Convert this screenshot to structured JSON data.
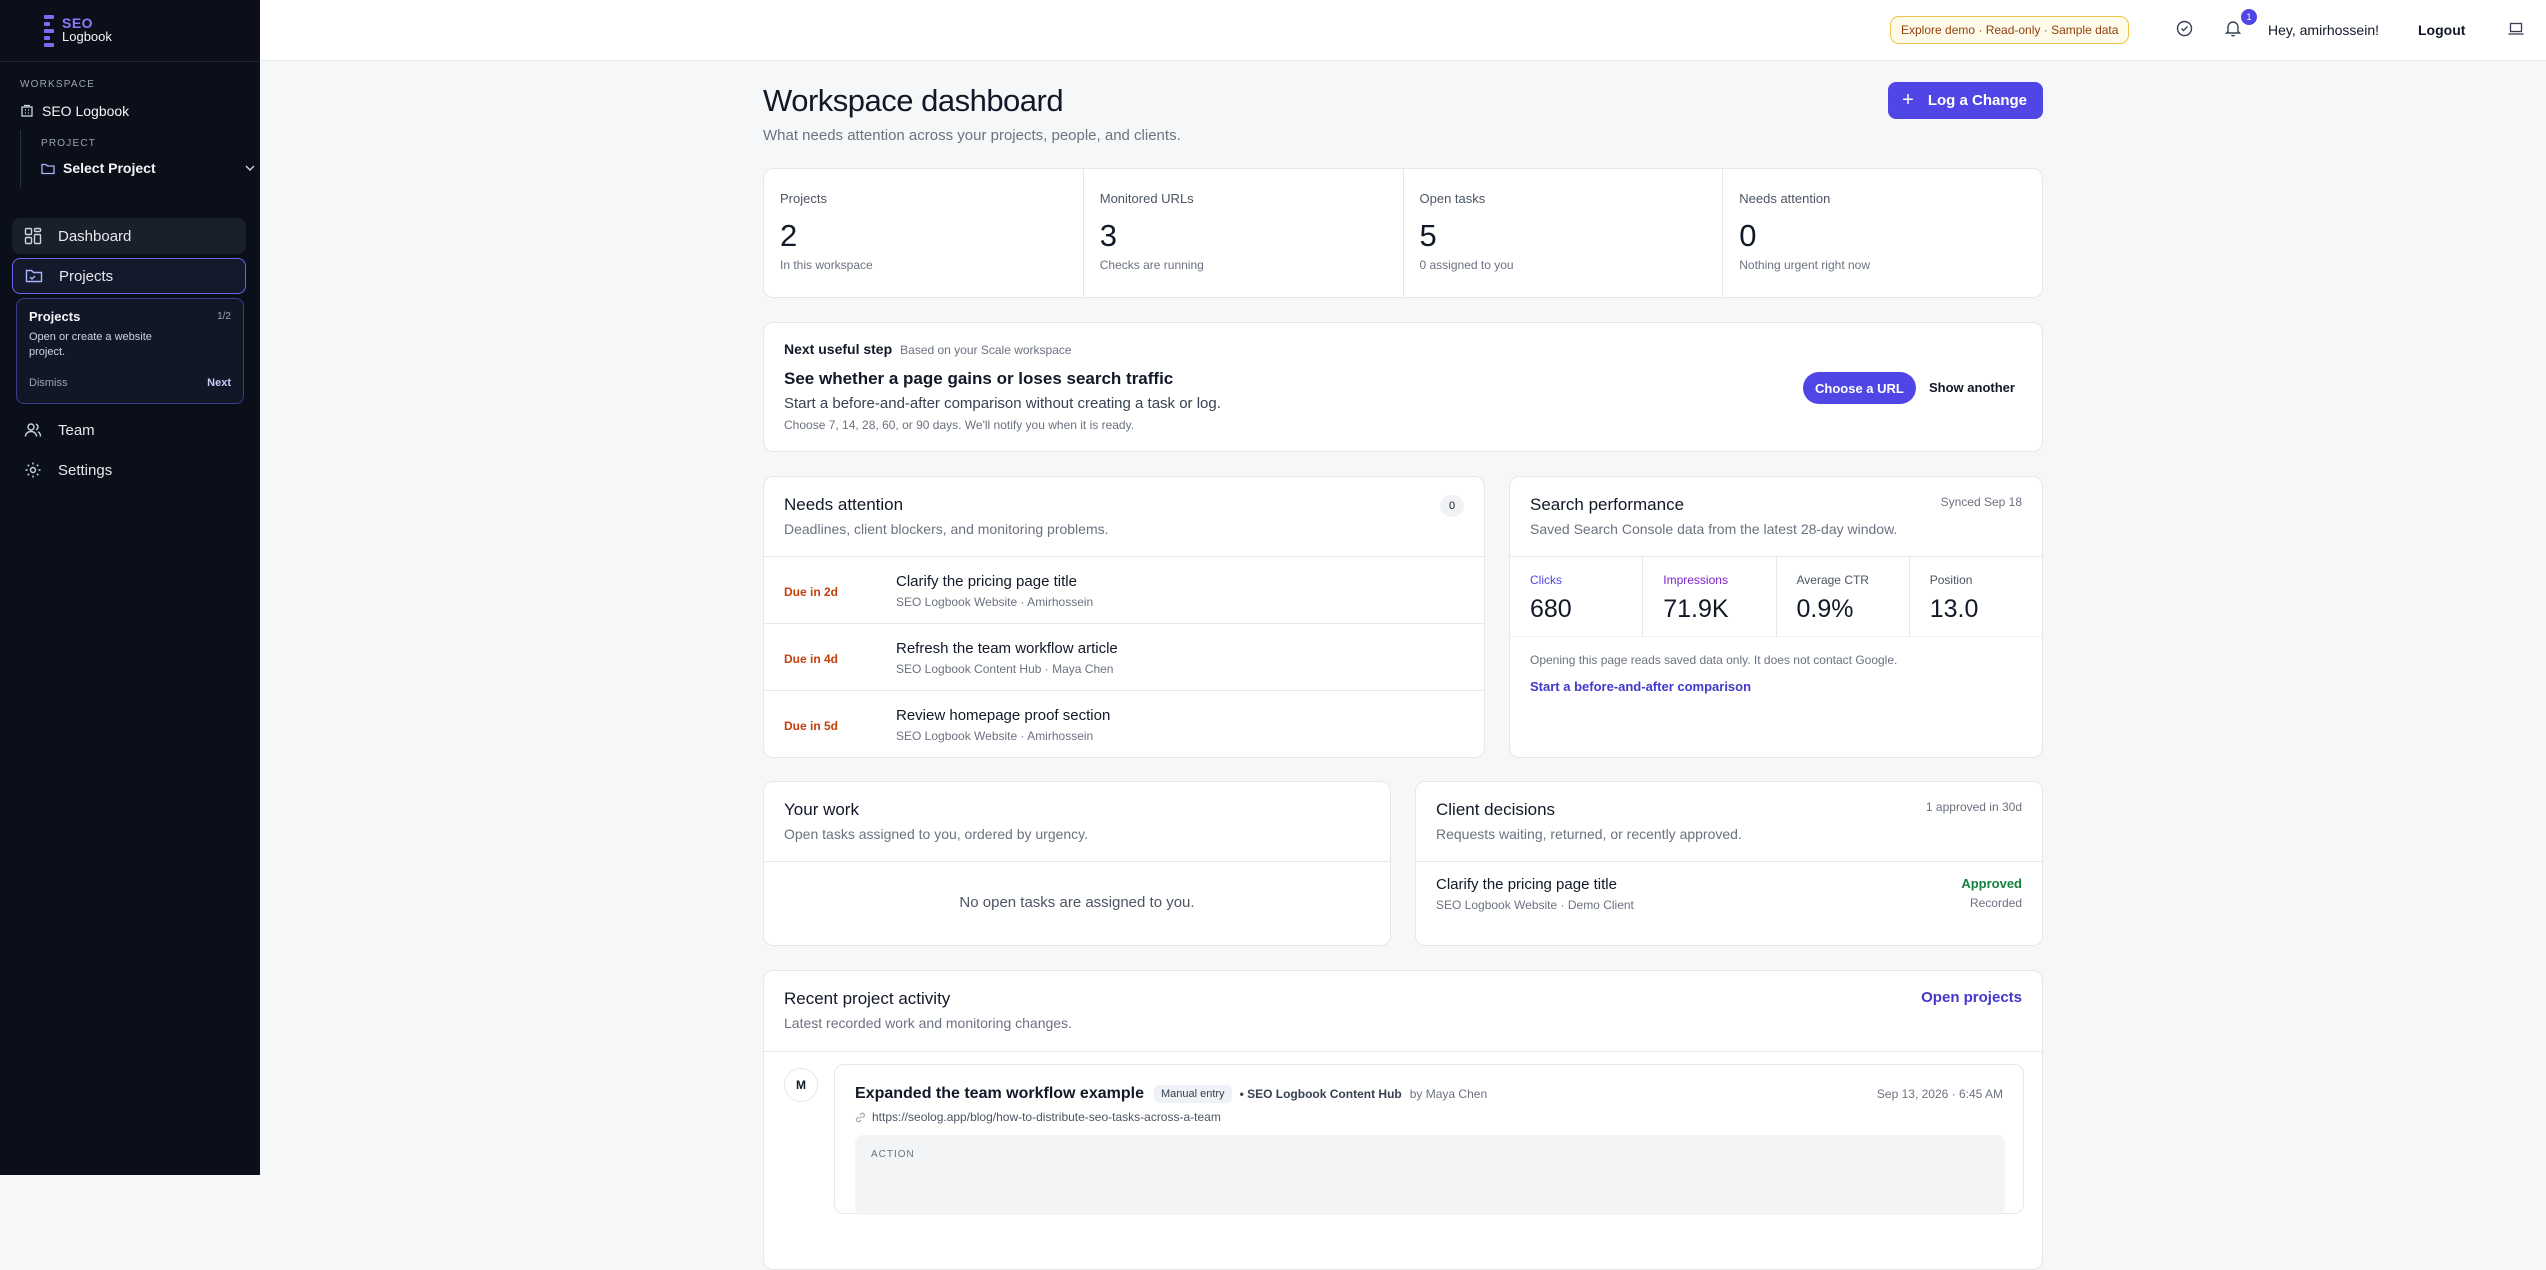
{
  "sidebar": {
    "logo_line1": "SEO",
    "logo_line2": "Logbook",
    "workspace_label": "WORKSPACE",
    "workspace_name": "SEO Logbook",
    "project_label": "PROJECT",
    "project_select": "Select Project",
    "nav": {
      "dashboard": "Dashboard",
      "projects": "Projects",
      "team": "Team",
      "settings": "Settings"
    },
    "tour": {
      "title": "Projects",
      "step": "1/2",
      "description": "Open or create a website project.",
      "dismiss": "Dismiss",
      "next": "Next"
    }
  },
  "topbar": {
    "demo_badge": "Explore demo · Read-only · Sample data",
    "notification_count": "1",
    "greeting": "Hey, amirhossein!",
    "logout": "Logout"
  },
  "header": {
    "title": "Workspace dashboard",
    "subtitle": "What needs attention across your projects, people, and clients.",
    "primary_button": "Log a Change"
  },
  "stats": [
    {
      "label": "Projects",
      "value": "2",
      "note": "In this workspace"
    },
    {
      "label": "Monitored URLs",
      "value": "3",
      "note": "Checks are running"
    },
    {
      "label": "Open tasks",
      "value": "5",
      "note": "0 assigned to you"
    },
    {
      "label": "Needs attention",
      "value": "0",
      "note": "Nothing urgent right now"
    }
  ],
  "next_step": {
    "label": "Next useful step",
    "context": "Based on your Scale workspace",
    "title": "See whether a page gains or loses search traffic",
    "description": "Start a before-and-after comparison without creating a task or log.",
    "note": "Choose 7, 14, 28, 60, or 90 days. We'll notify you when it is ready.",
    "primary": "Choose a URL",
    "secondary": "Show another"
  },
  "needs_attention": {
    "title": "Needs attention",
    "subtitle": "Deadlines, client blockers, and monitoring problems.",
    "count": "0",
    "rows": [
      {
        "due": "Due in 2d",
        "title": "Clarify the pricing page title",
        "meta": "SEO Logbook Website · Amirhossein"
      },
      {
        "due": "Due in 4d",
        "title": "Refresh the team workflow article",
        "meta": "SEO Logbook Content Hub · Maya Chen"
      },
      {
        "due": "Due in 5d",
        "title": "Review homepage proof section",
        "meta": "SEO Logbook Website · Amirhossein"
      }
    ]
  },
  "search_performance": {
    "title": "Search performance",
    "subtitle": "Saved Search Console data from the latest 28-day window.",
    "synced": "Synced Sep 18",
    "metrics": [
      {
        "label": "Clicks",
        "value": "680",
        "color": "#4f46e5"
      },
      {
        "label": "Impressions",
        "value": "71.9K",
        "color": "#7e22ce"
      },
      {
        "label": "Average CTR",
        "value": "0.9%",
        "color": "#4b5563"
      },
      {
        "label": "Position",
        "value": "13.0",
        "color": "#4b5563"
      }
    ],
    "note": "Opening this page reads saved data only. It does not contact Google.",
    "link": "Start a before-and-after comparison"
  },
  "your_work": {
    "title": "Your work",
    "subtitle": "Open tasks assigned to you, ordered by urgency.",
    "empty": "No open tasks are assigned to you."
  },
  "client_decisions": {
    "title": "Client decisions",
    "subtitle": "Requests waiting, returned, or recently approved.",
    "meta": "1 approved in 30d",
    "row": {
      "title": "Clarify the pricing page title",
      "meta": "SEO Logbook Website · Demo Client",
      "status": "Approved",
      "sub": "Recorded"
    }
  },
  "recent_activity": {
    "title": "Recent project activity",
    "subtitle": "Latest recorded work and monitoring changes.",
    "link": "Open projects",
    "item": {
      "avatar": "M",
      "title": "Expanded the team workflow example",
      "badge": "Manual entry",
      "project": "• SEO Logbook Content Hub",
      "by": "by Maya Chen",
      "date": "Sep 13, 2026 · 6:45 AM",
      "url": "https://seolog.app/blog/how-to-distribute-seo-tasks-across-a-team",
      "section_label": "ACTION"
    }
  },
  "colors": {
    "accent": "#4f46e5",
    "sidebar_bg": "#0b0f1a",
    "due": "#c2410c",
    "approved": "#15803d"
  }
}
